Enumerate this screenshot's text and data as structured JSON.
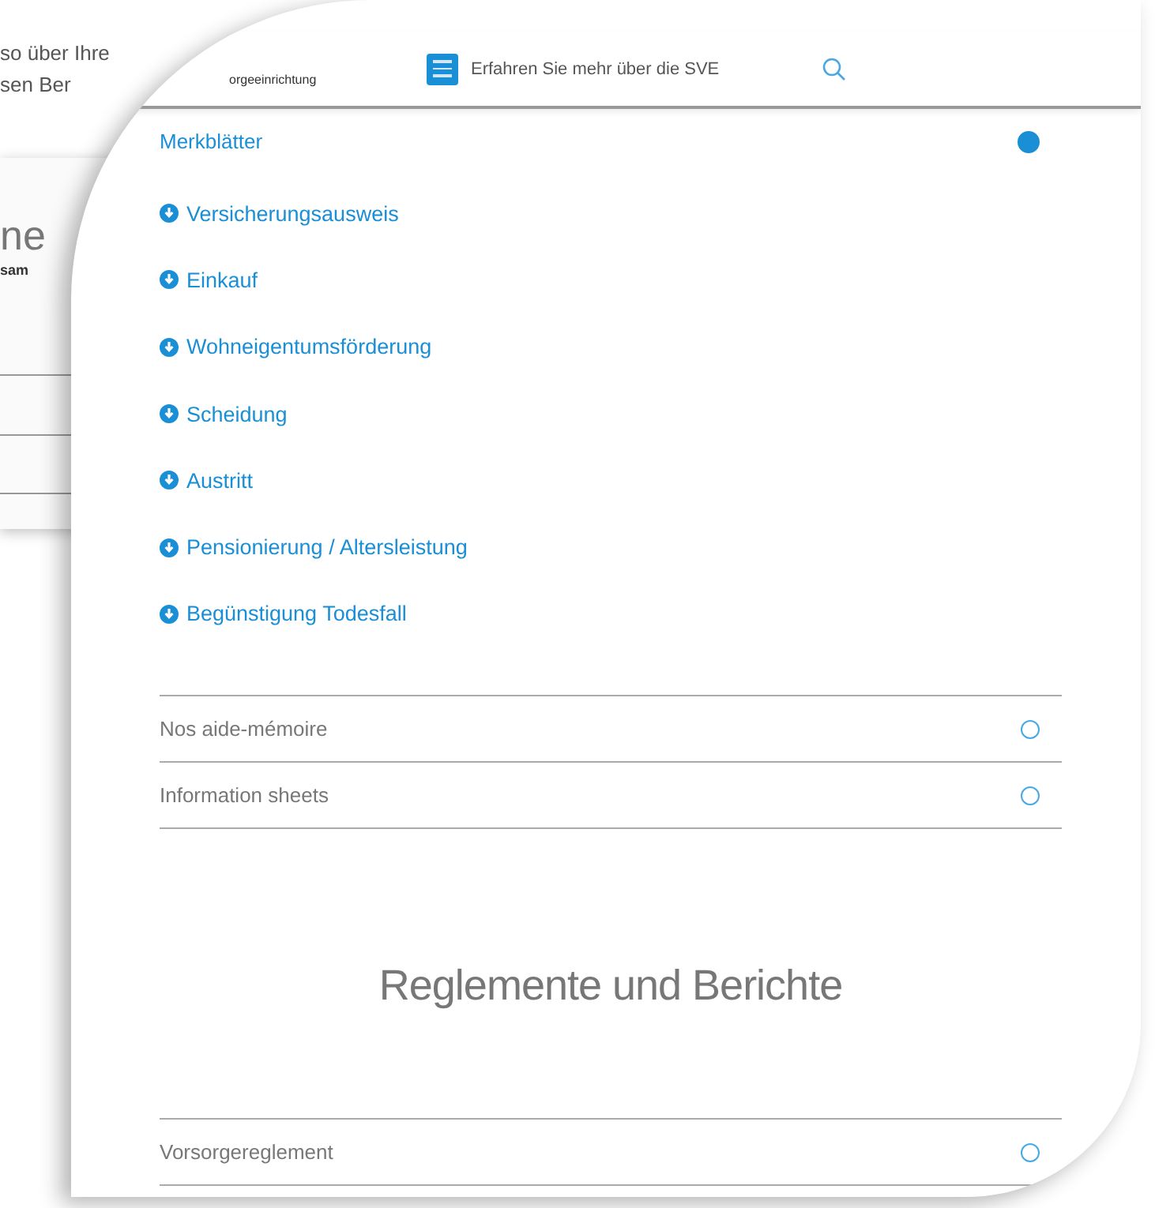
{
  "background": {
    "lines": [
      "so über Ihre",
      "sen Ber"
    ],
    "heading": "ne",
    "subtext": "sam"
  },
  "header": {
    "logo_text": "orgeeinrichtung",
    "menu_label": "Erfahren Sie mehr über die SVE"
  },
  "accordions": [
    {
      "title": "Merkblätter",
      "expanded": true,
      "items": [
        "Versicherungsausweis",
        "Einkauf",
        "Wohneigentumsförderung",
        "Scheidung",
        "Austritt",
        "Pensionierung / Altersleistung",
        "Begünstigung Todesfall"
      ]
    },
    {
      "title": "Nos aide-mémoire",
      "expanded": false
    },
    {
      "title": "Information sheets",
      "expanded": false
    }
  ],
  "section_heading": "Reglemente und Berichte",
  "accordions_2": [
    {
      "title": "Vorsorgereglement",
      "expanded": false
    }
  ]
}
